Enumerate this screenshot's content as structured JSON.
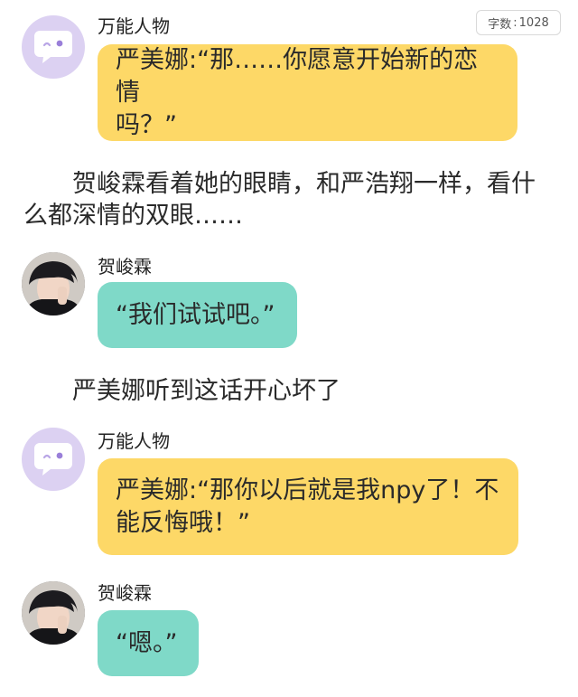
{
  "word_count": {
    "label": "字数",
    "sep": ":",
    "value": "1028"
  },
  "messages": [
    {
      "speaker": "万能人物",
      "avatar_icon": "speech-bubble-smile-icon",
      "line1": "严美娜:“那……你愿意开始新的恋情",
      "line2": "吗？”"
    },
    {
      "narration_line1": "贺峻霖看着她的眼睛，和严浩翔一样，看什",
      "narration_line2": "么都深情的双眼……"
    },
    {
      "speaker": "贺峻霖",
      "avatar_icon": "profile-photo-icon",
      "text": "“我们试试吧。”"
    },
    {
      "narration": "严美娜听到这话开心坏了"
    },
    {
      "speaker": "万能人物",
      "avatar_icon": "speech-bubble-smile-icon",
      "line1": "严美娜:“那你以后就是我npy了！不",
      "line2": "能反悔哦！”"
    },
    {
      "speaker": "贺峻霖",
      "avatar_icon": "profile-photo-icon",
      "text": "“嗯。”"
    }
  ],
  "colors": {
    "yellow_bubble": "#fdd867",
    "teal_bubble": "#7fd9c8",
    "bot_avatar_bg": "#dcd1f2"
  }
}
